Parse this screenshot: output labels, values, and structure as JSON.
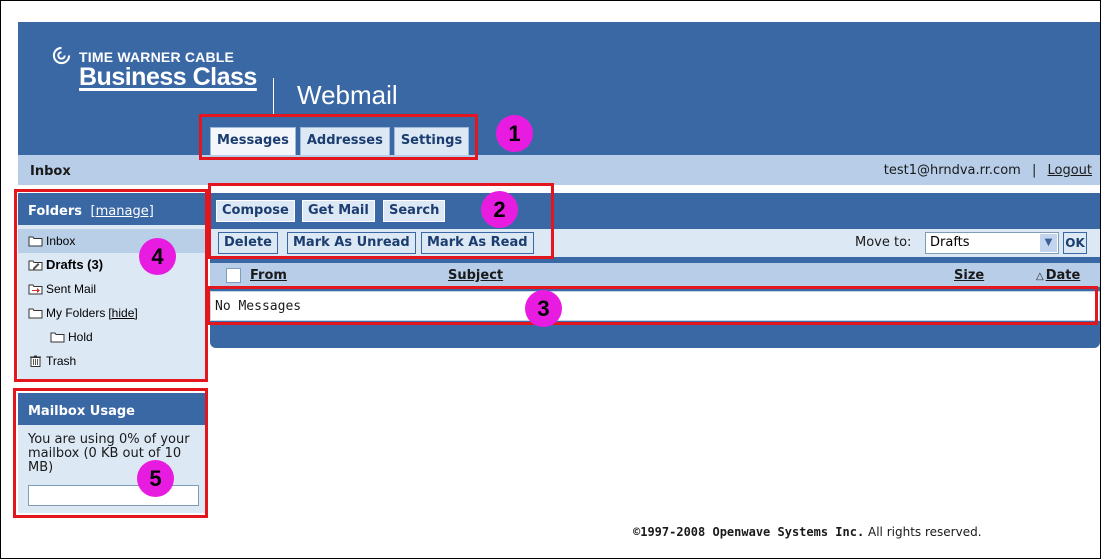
{
  "header": {
    "brand_top": "TIME WARNER CABLE",
    "brand_bottom": "Business Class",
    "app_title": "Webmail",
    "tabs": [
      {
        "label": "Messages",
        "active": true
      },
      {
        "label": "Addresses",
        "active": false
      },
      {
        "label": "Settings",
        "active": false
      }
    ]
  },
  "subbar": {
    "page_title": "Inbox",
    "user_email": "test1@hrndva.rr.com",
    "separator": "|",
    "logout_label": "Logout"
  },
  "folders_panel": {
    "title": "Folders",
    "manage_label": "[manage]",
    "items": [
      {
        "label": "Inbox",
        "icon": "folder-icon",
        "selected": true
      },
      {
        "label": "Drafts (3)",
        "icon": "drafts-icon",
        "bold": true
      },
      {
        "label": "Sent Mail",
        "icon": "sent-mail-icon"
      },
      {
        "label": "My Folders",
        "icon": "folder-icon",
        "extra": "[hide]"
      },
      {
        "label": "Hold",
        "icon": "folder-icon",
        "sub": true
      },
      {
        "label": "Trash",
        "icon": "trash-icon"
      }
    ]
  },
  "usage_panel": {
    "title": "Mailbox Usage",
    "text": "You are using 0% of your mailbox (0 KB out of 10 MB)",
    "usage_fraction": 0
  },
  "toolbar": {
    "compose_label": "Compose",
    "get_mail_label": "Get Mail",
    "search_label": "Search",
    "delete_label": "Delete",
    "mark_unread_label": "Mark As Unread",
    "mark_read_label": "Mark As Read",
    "move_to_label": "Move to:",
    "move_to_value": "Drafts",
    "ok_label": "OK"
  },
  "message_list": {
    "columns": {
      "from": "From",
      "subject": "Subject",
      "size": "Size",
      "date": "Date"
    },
    "sort_indicator": "△",
    "empty_text": "No Messages"
  },
  "annotations": [
    "1",
    "2",
    "3",
    "4",
    "5"
  ],
  "footer": {
    "copyright": "©1997-2008 Openwave Systems Inc.",
    "rights": "All rights reserved."
  },
  "colors": {
    "header_blue": "#3a68a5",
    "light_blue": "#b7cde8",
    "pale_blue": "#dde8f5",
    "annotation_red": "#e2161c",
    "annotation_magenta": "#e81ce0"
  }
}
